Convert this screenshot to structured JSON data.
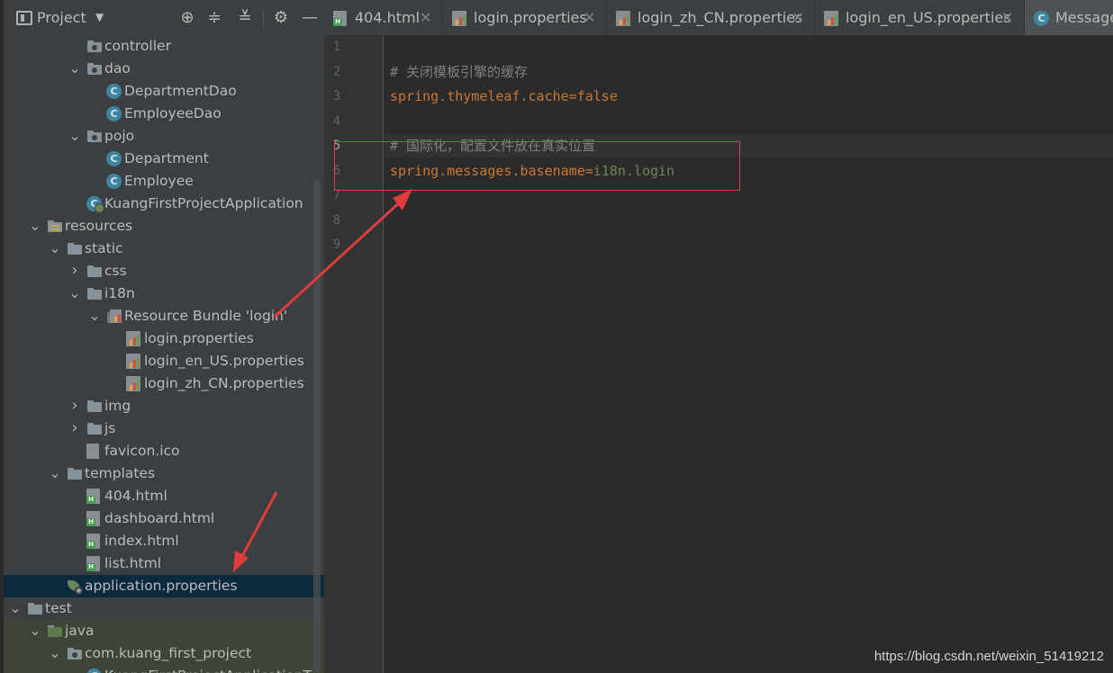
{
  "project_panel": {
    "title": "Project",
    "tree": [
      {
        "label": "controller",
        "icon": "package-folder",
        "indent": 3,
        "arrow": ""
      },
      {
        "label": "dao",
        "icon": "package-folder",
        "indent": 3,
        "arrow": "open"
      },
      {
        "label": "DepartmentDao",
        "icon": "java-class",
        "indent": 4,
        "arrow": ""
      },
      {
        "label": "EmployeeDao",
        "icon": "java-class",
        "indent": 4,
        "arrow": ""
      },
      {
        "label": "pojo",
        "icon": "package-folder",
        "indent": 3,
        "arrow": "open"
      },
      {
        "label": "Department",
        "icon": "java-class",
        "indent": 4,
        "arrow": ""
      },
      {
        "label": "Employee",
        "icon": "java-class",
        "indent": 4,
        "arrow": ""
      },
      {
        "label": "KuangFirstProjectApplication",
        "icon": "spring-app-class",
        "indent": 3,
        "arrow": ""
      },
      {
        "label": "resources",
        "icon": "resources-folder",
        "indent": 1,
        "arrow": "open"
      },
      {
        "label": "static",
        "icon": "folder",
        "indent": 2,
        "arrow": "open"
      },
      {
        "label": "css",
        "icon": "folder",
        "indent": 3,
        "arrow": "closed"
      },
      {
        "label": "i18n",
        "icon": "folder",
        "indent": 3,
        "arrow": "open"
      },
      {
        "label": "Resource Bundle 'login'",
        "icon": "resource-bundle",
        "indent": 4,
        "arrow": "open"
      },
      {
        "label": "login.properties",
        "icon": "properties-file",
        "indent": 5,
        "arrow": ""
      },
      {
        "label": "login_en_US.properties",
        "icon": "properties-file",
        "indent": 5,
        "arrow": ""
      },
      {
        "label": "login_zh_CN.properties",
        "icon": "properties-file",
        "indent": 5,
        "arrow": ""
      },
      {
        "label": "img",
        "icon": "folder",
        "indent": 3,
        "arrow": "closed"
      },
      {
        "label": "js",
        "icon": "folder",
        "indent": 3,
        "arrow": "closed"
      },
      {
        "label": "favicon.ico",
        "icon": "generic-file",
        "indent": 3,
        "arrow": ""
      },
      {
        "label": "templates",
        "icon": "folder",
        "indent": 2,
        "arrow": "open"
      },
      {
        "label": "404.html",
        "icon": "html-file",
        "indent": 3,
        "arrow": ""
      },
      {
        "label": "dashboard.html",
        "icon": "html-file",
        "indent": 3,
        "arrow": ""
      },
      {
        "label": "index.html",
        "icon": "html-file",
        "indent": 3,
        "arrow": ""
      },
      {
        "label": "list.html",
        "icon": "html-file",
        "indent": 3,
        "arrow": ""
      },
      {
        "label": "application.properties",
        "icon": "spring-properties-file",
        "indent": 2,
        "arrow": "",
        "selected": true
      },
      {
        "label": "test",
        "icon": "folder",
        "indent": 0,
        "arrow": "open"
      },
      {
        "label": "java",
        "icon": "test-source-folder",
        "indent": 1,
        "arrow": "open"
      },
      {
        "label": "com.kuang_first_project",
        "icon": "package-folder",
        "indent": 2,
        "arrow": "open"
      },
      {
        "label": "KuangFirstProjectApplicationT",
        "icon": "spring-app-class",
        "indent": 3,
        "arrow": ""
      }
    ]
  },
  "tabs": [
    {
      "label": "404.html",
      "icon": "html-file",
      "closable": true
    },
    {
      "label": "login.properties",
      "icon": "properties-file",
      "closable": true
    },
    {
      "label": "login_zh_CN.properties",
      "icon": "properties-file",
      "closable": true
    },
    {
      "label": "login_en_US.properties",
      "icon": "properties-file",
      "closable": true
    },
    {
      "label": "Message",
      "icon": "java-class",
      "closable": false
    }
  ],
  "editor": {
    "line_numbers": [
      "1",
      "2",
      "3",
      "4",
      "5",
      "6",
      "7",
      "8",
      "9"
    ],
    "current_line": "5",
    "lines": [
      {
        "comment": ""
      },
      {
        "comment": "# 关闭模板引擎的缓存"
      },
      {
        "key": "spring.thymeleaf.cache",
        "eq": "=",
        "value": "false",
        "value_style": "keyword"
      },
      {
        "comment": ""
      },
      {
        "comment": "# 国际化，配置文件放在真实位置"
      },
      {
        "key": "spring.messages.basename",
        "eq": "=",
        "value": "i18n.login",
        "value_style": "string"
      },
      {
        "comment": ""
      },
      {
        "comment": ""
      },
      {
        "comment": ""
      }
    ]
  },
  "close_glyph": "✕",
  "watermark": "https://blog.csdn.net/weixin_51419212",
  "colors": {
    "annotation": "#e03c3c",
    "selection": "#0d293e",
    "keyword": "#cc7832",
    "string": "#6a8759",
    "comment": "#808080"
  }
}
